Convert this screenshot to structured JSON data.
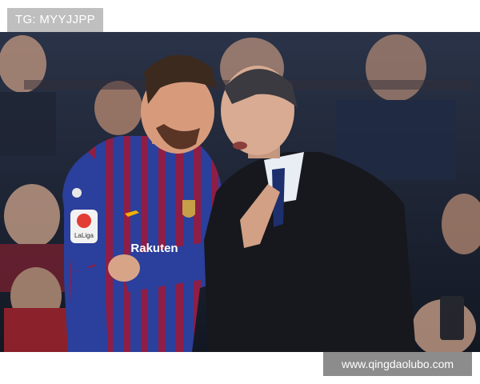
{
  "overlay": {
    "top_left_label": "TG: MYYJJPP",
    "bottom_right_label": "www.qingdaolubo.com"
  },
  "photo": {
    "description_alt": "",
    "shirt_sponsor_text": "Rakuten",
    "sleeve_badge_text": "LaLiga"
  },
  "colors": {
    "jersey_blue": "#2b3f9c",
    "jersey_stripe": "#8e1e46",
    "coat": "#17181d",
    "tie": "#1d2f6d",
    "crowd_bg": "#1b2333",
    "label_top_bg": "#bfbfbf",
    "label_bottom_bg": "#8c8c8c"
  }
}
